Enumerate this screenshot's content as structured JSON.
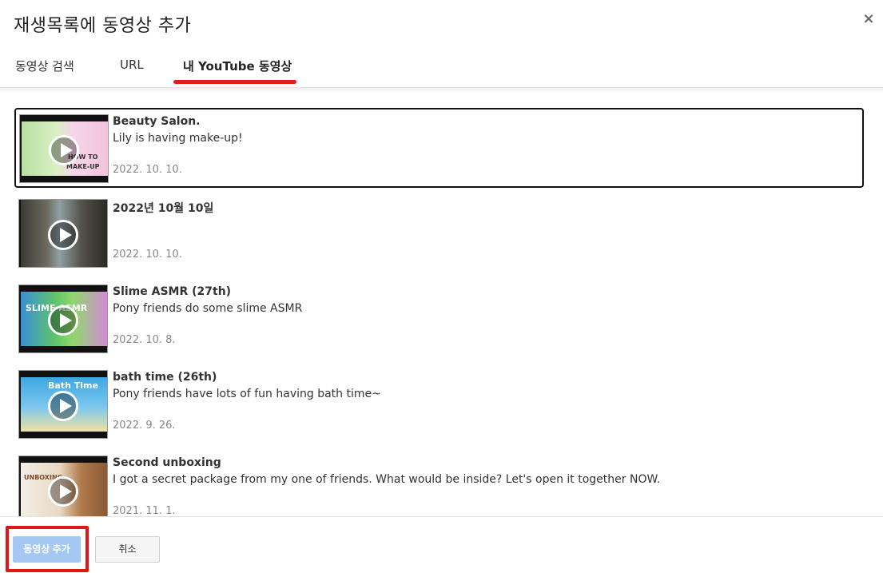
{
  "dialog": {
    "title": "재생목록에 동영상 추가",
    "close_label": "×"
  },
  "tabs": [
    {
      "label": "동영상 검색",
      "active": false
    },
    {
      "label": "URL",
      "active": false
    },
    {
      "label": "내 YouTube 동영상",
      "active": true
    }
  ],
  "videos": [
    {
      "title": "Beauty Salon.",
      "description": "Lily is having make-up!",
      "date": "2022. 10. 10.",
      "selected": true,
      "thumb_text": "HOW TO MAKE-UP"
    },
    {
      "title": "2022년 10월 10일",
      "description": "",
      "date": "2022. 10. 10.",
      "selected": false,
      "thumb_text": ""
    },
    {
      "title": "Slime ASMR (27th)",
      "description": "Pony friends do some slime ASMR",
      "date": "2022. 10. 8.",
      "selected": false,
      "thumb_text": "SLIME ASMR"
    },
    {
      "title": "bath time (26th)",
      "description": "Pony friends have lots of fun having bath time~",
      "date": "2022. 9. 26.",
      "selected": false,
      "thumb_text": "Bath Time"
    },
    {
      "title": "Second unboxing",
      "description": "I got a secret package from my one of friends. What would be inside? Let's open it together NOW.",
      "date": "2021. 11. 1.",
      "selected": false,
      "thumb_text": "UNBOXING SECRET PACKAGE"
    }
  ],
  "footer": {
    "add_label": "동영상 추가",
    "cancel_label": "취소"
  },
  "colors": {
    "tab_underline": "#e21b1b",
    "add_button_bg": "#a5c8f2",
    "highlight_frame": "#e01717"
  }
}
